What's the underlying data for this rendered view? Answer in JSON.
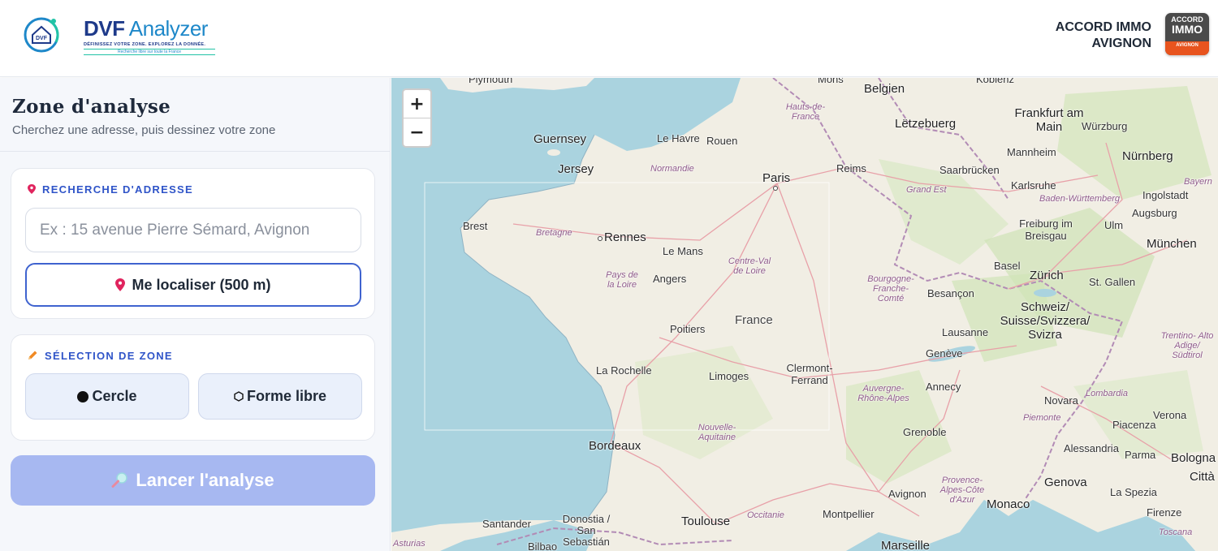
{
  "header": {
    "logo_title_part1": "DVF",
    "logo_title_part2": " Analyzer",
    "logo_tagline": "DÉFINISSEZ VOTRE ZONE. EXPLOREZ LA DONNÉE.",
    "logo_subtagline": "Recherche libre sur toute la France",
    "logo_icon_text": "DVF",
    "brand_line1": "ACCORD IMMO",
    "brand_line2": "AVIGNON",
    "badge_line1": "ACCORD",
    "badge_line2": "IMMO",
    "badge_line3": "AVIGNON"
  },
  "sidebar": {
    "title": "Zone d'analyse",
    "subtitle": "Cherchez une adresse, puis dessinez votre zone",
    "address_section": {
      "label": "RECHERCHE D'ADRESSE",
      "icon": "pin-icon",
      "input_value": "",
      "input_placeholder": "Ex : 15 avenue Pierre Sémard, Avignon",
      "locate_button": "Me localiser (500 m)"
    },
    "zone_section": {
      "label": "SÉLECTION DE ZONE",
      "icon": "pencil-icon",
      "circle_button": "Cercle",
      "freeform_button": "Forme libre"
    },
    "launch_button": "Lancer l'analyse"
  },
  "map": {
    "zoom_in": "+",
    "zoom_out": "−",
    "labels": {
      "plymouth": "Plymouth",
      "guernsey": "Guernsey",
      "jersey": "Jersey",
      "brest": "Brest",
      "bretagne": "Bretagne",
      "rennes": "Rennes",
      "le_havre": "Le Havre",
      "rouen": "Rouen",
      "normandie": "Normandie",
      "paris": "Paris",
      "reims": "Reims",
      "hauts_de_france": "Hauts-de-France",
      "belgien": "Belgien",
      "mons": "Mons",
      "koblenz": "Koblenz",
      "letzebuerg": "Lëtzebuerg",
      "frankfurt": "Frankfurt am Main",
      "wurzburg": "Würzburg",
      "mannheim": "Mannheim",
      "nurnberg": "Nürnberg",
      "saarbrucken": "Saarbrücken",
      "karlsruhe": "Karlsruhe",
      "bw": "Baden-Württemberg",
      "ingolstadt": "Ingolstadt",
      "bayern": "Bayern",
      "augsburg": "Augsburg",
      "ulm": "Ulm",
      "grand_est": "Grand Est",
      "freiburg": "Freiburg im Breisgau",
      "munchen": "München",
      "basel": "Basel",
      "zurich": "Zürich",
      "st_gallen": "St. Gallen",
      "le_mans": "Le Mans",
      "angers": "Angers",
      "pays_de_la_loire": "Pays de la Loire",
      "centre_val_de_loire": "Centre-Val de Loire",
      "bourgogne": "Bourgogne-Franche-Comté",
      "besancon": "Besançon",
      "schweiz": "Schweiz/ Suisse/Svizzera/ Svizra",
      "lausanne": "Lausanne",
      "france": "France",
      "poitiers": "Poitiers",
      "la_rochelle": "La Rochelle",
      "limoges": "Limoges",
      "clermont": "Clermont- Ferrand",
      "geneve": "Genève",
      "trentino": "Trentino- Alto Adige/ Südtirol",
      "annecy": "Annecy",
      "auvergne": "Auvergne- Rhône-Alpes",
      "novara": "Novara",
      "lombardia": "Lombardia",
      "verona": "Verona",
      "nouvelle_aquitaine": "Nouvelle- Aquitaine",
      "grenoble": "Grenoble",
      "piemonte": "Piemonte",
      "piacenza": "Piacenza",
      "bordeaux": "Bordeaux",
      "alessandria": "Alessandria",
      "parma": "Parma",
      "bologna": "Bologna",
      "provence": "Provence- Alpes-Côte d'Azur",
      "genova": "Genova",
      "citta": "Città",
      "la_spezia": "La Spezia",
      "avignon": "Avignon",
      "monaco": "Monaco",
      "firenze": "Firenze",
      "santander": "Santander",
      "donostia": "Donostia / San Sebastián",
      "toulouse": "Toulouse",
      "occitanie": "Occitanie",
      "montpellier": "Montpellier",
      "toscana": "Toscana",
      "marseille": "Marseille",
      "asturias": "Asturias",
      "bilbao": "Bilbao"
    }
  }
}
